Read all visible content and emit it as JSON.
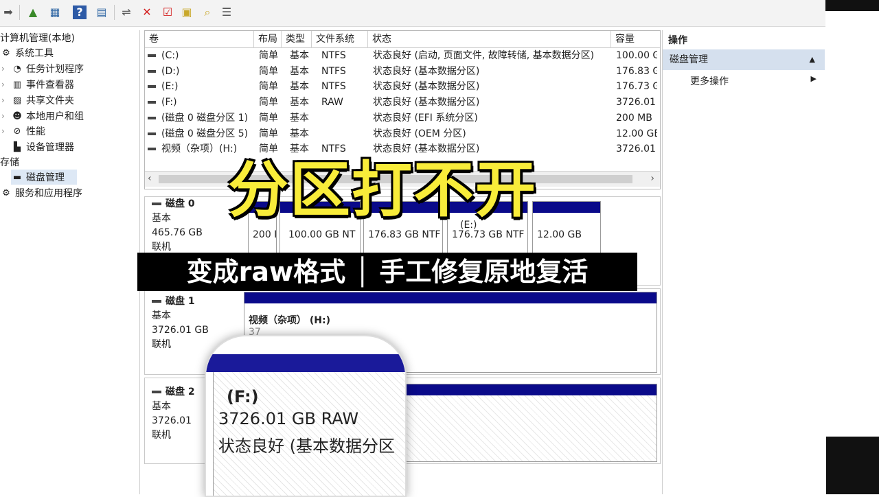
{
  "toolbar": {
    "icons": [
      "arrow-right-icon",
      "up-folder-icon",
      "show-hide-tree-icon",
      "help-icon",
      "properties-icon",
      "connect-icon",
      "delete-icon",
      "check-icon",
      "open-folder-icon",
      "search-folder-icon",
      "list-view-icon"
    ]
  },
  "tree": {
    "root": "计算机管理(本地)",
    "items": [
      {
        "label": "系统工具",
        "level": 0
      },
      {
        "label": "任务计划程序",
        "level": 1
      },
      {
        "label": "事件查看器",
        "level": 1
      },
      {
        "label": "共享文件夹",
        "level": 1
      },
      {
        "label": "本地用户和组",
        "level": 1
      },
      {
        "label": "性能",
        "level": 1
      },
      {
        "label": "设备管理器",
        "level": 1
      },
      {
        "label": "存储",
        "level": 0
      },
      {
        "label": "磁盘管理",
        "level": 1
      },
      {
        "label": "服务和应用程序",
        "level": 0
      }
    ]
  },
  "volume_table": {
    "columns": [
      "卷",
      "布局",
      "类型",
      "文件系统",
      "状态",
      "容量"
    ],
    "rows": [
      {
        "vol": "(C:)",
        "layout": "简单",
        "type": "基本",
        "fs": "NTFS",
        "status": "状态良好 (启动, 页面文件, 故障转储, 基本数据分区)",
        "cap": "100.00 G"
      },
      {
        "vol": "(D:)",
        "layout": "简单",
        "type": "基本",
        "fs": "NTFS",
        "status": "状态良好 (基本数据分区)",
        "cap": "176.83 G"
      },
      {
        "vol": "(E:)",
        "layout": "简单",
        "type": "基本",
        "fs": "NTFS",
        "status": "状态良好 (基本数据分区)",
        "cap": "176.73 G"
      },
      {
        "vol": "(F:)",
        "layout": "简单",
        "type": "基本",
        "fs": "RAW",
        "status": "状态良好 (基本数据分区)",
        "cap": "3726.01"
      },
      {
        "vol": "(磁盘 0 磁盘分区 1)",
        "layout": "简单",
        "type": "基本",
        "fs": "",
        "status": "状态良好 (EFI 系统分区)",
        "cap": "200 MB"
      },
      {
        "vol": "(磁盘 0 磁盘分区 5)",
        "layout": "简单",
        "type": "基本",
        "fs": "",
        "status": "状态良好 (OEM 分区)",
        "cap": "12.00 GE"
      },
      {
        "vol": "视频（杂项）(H:)",
        "layout": "简单",
        "type": "基本",
        "fs": "NTFS",
        "status": "状态良好 (基本数据分区)",
        "cap": "3726.01"
      }
    ]
  },
  "disks": [
    {
      "name": "磁盘 0",
      "type": "基本",
      "size": "465.76 GB",
      "status": "联机"
    },
    {
      "name": "磁盘 1",
      "type": "基本",
      "size": "3726.01 GB",
      "status": "联机"
    },
    {
      "name": "磁盘 2",
      "type": "基本",
      "size": "3726.01",
      "status": "联机"
    }
  ],
  "disk0_parts": [
    "200 I",
    "100.00 GB NT",
    "176.83 GB NTF",
    "(E:)",
    "176.73 GB NTF",
    "12.00 GB"
  ],
  "disk1_part": {
    "title": "视频（杂项）  (H:)",
    "line2": "37"
  },
  "actions": {
    "title": "操作",
    "section": "磁盘管理",
    "section_arrow": "▲",
    "more": "更多操作",
    "more_arrow": "▶"
  },
  "overlay": {
    "title": "分区打不开",
    "subtitle": "变成raw格式 │ 手工修复原地复活"
  },
  "magnifier": {
    "line1": "(F:)",
    "line2": "3726.01 GB RAW",
    "line3": "状态良好 (基本数据分区"
  },
  "colors": {
    "bar": "#0a0a8a",
    "overlay_yellow": "#f8ec3a",
    "selected": "#dde8f5"
  }
}
